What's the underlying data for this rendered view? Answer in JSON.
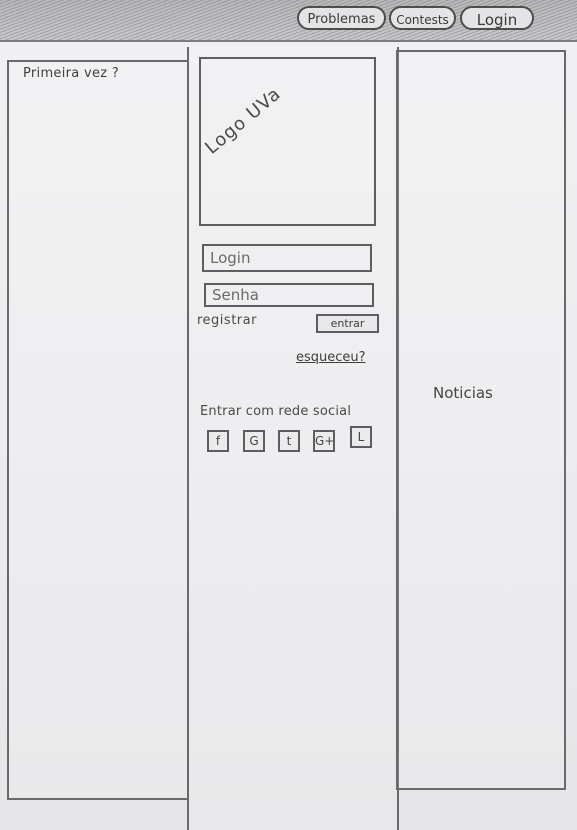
{
  "nav": {
    "problemas": "Problemas",
    "contests": "Contests",
    "login": "Login"
  },
  "left_panel": {
    "first_time": "Primeira vez ?"
  },
  "center_panel": {
    "logo_text": "Logo UVa",
    "login_placeholder": "Login",
    "password_placeholder": "Senha",
    "register_link": "registrar",
    "enter_button": "entrar",
    "forgot_link": "esqueceu?",
    "social_title": "Entrar com rede social",
    "social_buttons": [
      {
        "label": "f",
        "icon": "facebook-icon"
      },
      {
        "label": "G",
        "icon": "github-icon"
      },
      {
        "label": "t",
        "icon": "twitter-icon"
      },
      {
        "label": "G+",
        "icon": "google-plus-icon"
      },
      {
        "label": "L",
        "icon": "linkedin-icon"
      }
    ]
  },
  "right_panel": {
    "news_label": "Noticias"
  }
}
